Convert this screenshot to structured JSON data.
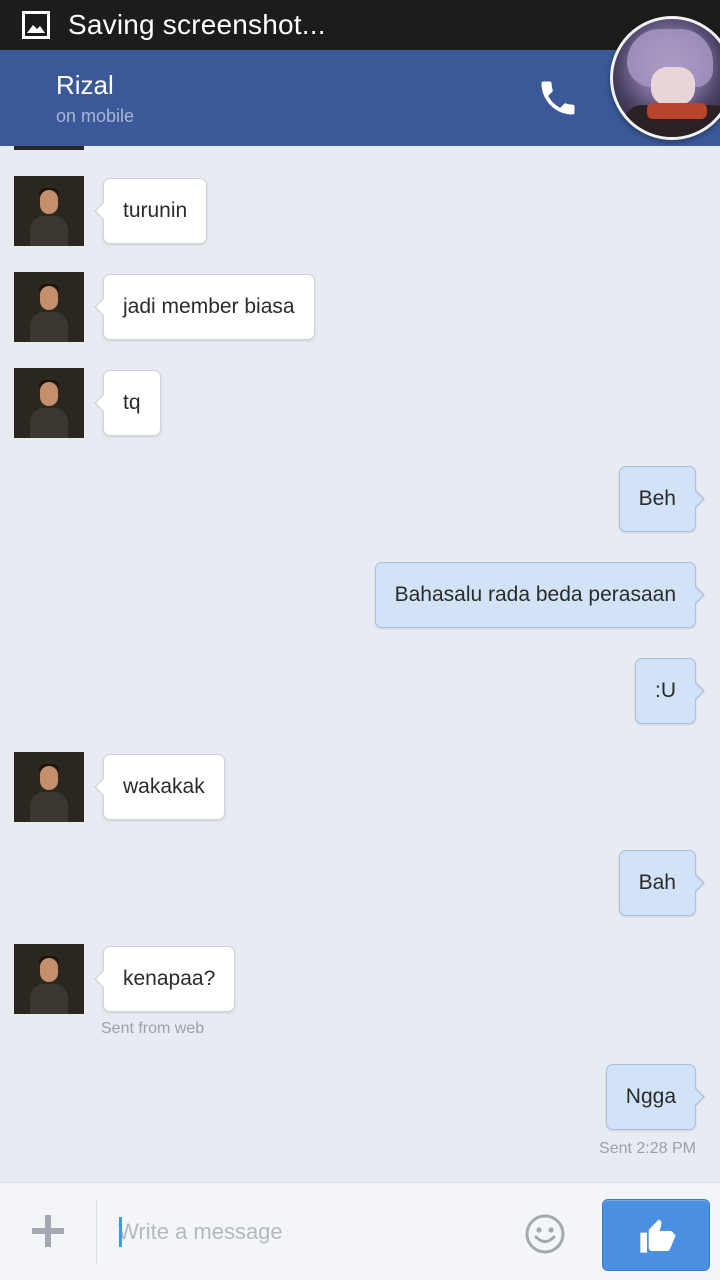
{
  "status_bar": {
    "icon": "screenshot-icon",
    "text": "Saving screenshot..."
  },
  "header": {
    "contact_name": "Rizal",
    "contact_status": "on mobile",
    "call_icon": "phone-icon",
    "brand_color": "#3b5998"
  },
  "messages": [
    {
      "direction": "in",
      "text": "turunin"
    },
    {
      "direction": "in",
      "text": "jadi member biasa"
    },
    {
      "direction": "in",
      "text": "tq"
    },
    {
      "direction": "out",
      "text": "Beh"
    },
    {
      "direction": "out",
      "text": "Bahasalu rada beda perasaan"
    },
    {
      "direction": "out",
      "text": ":U"
    },
    {
      "direction": "in",
      "text": "wakakak"
    },
    {
      "direction": "out",
      "text": "Bah"
    },
    {
      "direction": "in",
      "text": "kenapaa?",
      "meta": "Sent from web"
    },
    {
      "direction": "out",
      "text": "Ngga",
      "meta": "Sent 2:28 PM"
    }
  ],
  "composer": {
    "placeholder": "Write a message",
    "value": "",
    "plus_icon": "plus-icon",
    "emoji_icon": "smiley-icon",
    "send_icon": "thumbs-up-icon",
    "send_color": "#4a8fe0"
  },
  "colors": {
    "background": "#e8ebf2",
    "incoming_bubble": "#ffffff",
    "outgoing_bubble": "#d3e3f7"
  }
}
